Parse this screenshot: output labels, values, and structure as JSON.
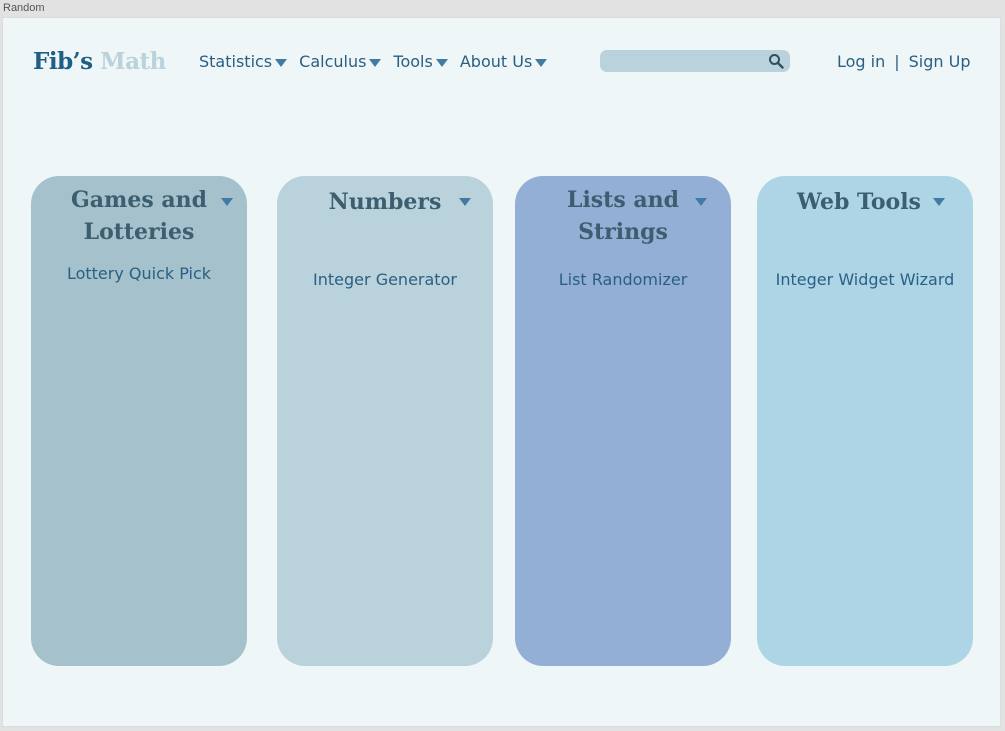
{
  "window": {
    "title": "Random"
  },
  "logo": {
    "part1": "Fib’s",
    "part2": "Math"
  },
  "nav": [
    {
      "label": "Statistics"
    },
    {
      "label": "Calculus"
    },
    {
      "label": "Tools"
    },
    {
      "label": "About Us"
    }
  ],
  "search": {
    "placeholder": ""
  },
  "auth": {
    "login": "Log in",
    "separator": "|",
    "signup": "Sign Up"
  },
  "cards": [
    {
      "title_line1": "Games and",
      "title_line2": "Lotteries",
      "link": "Lottery Quick Pick",
      "color": "#a4c1cc"
    },
    {
      "title_line1": "Numbers",
      "title_line2": "",
      "link": "Integer Generator",
      "color": "#b9d2db"
    },
    {
      "title_line1": "Lists and",
      "title_line2": "Strings",
      "link": "List Randomizer",
      "color": "#94afd6"
    },
    {
      "title_line1": "Web Tools",
      "title_line2": "",
      "link": "Integer Widget Wizard",
      "color": "#add5e6"
    }
  ],
  "colors": {
    "accent": "#2a5f84",
    "background": "#eef6f7"
  }
}
